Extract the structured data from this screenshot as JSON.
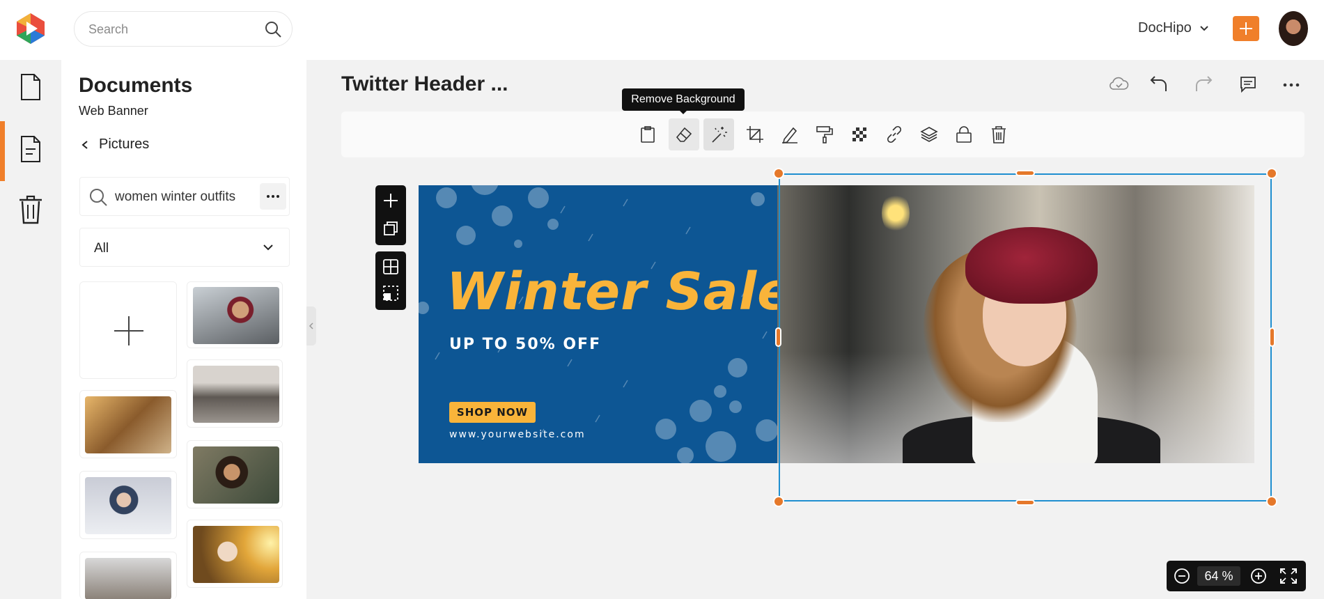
{
  "app": {
    "user_menu": "DocHipo"
  },
  "search": {
    "placeholder": "Search"
  },
  "panel": {
    "title": "Documents",
    "subtitle": "Web Banner",
    "back_label": "Pictures",
    "search_value": "women winter outfits",
    "filter": "All"
  },
  "document": {
    "title": "Twitter Header ..."
  },
  "tooltip": "Remove Background",
  "banner": {
    "headline": "Winter Sale",
    "subhead": "UP TO 50% OFF",
    "cta": "SHOP NOW",
    "website": "www.yourwebsite.com"
  },
  "zoom": {
    "value": "64",
    "unit": "%"
  },
  "colors": {
    "accent": "#f07f2a",
    "banner_bg": "#0d5694",
    "headline": "#f9b43a",
    "selection": "#1f8fd0"
  }
}
